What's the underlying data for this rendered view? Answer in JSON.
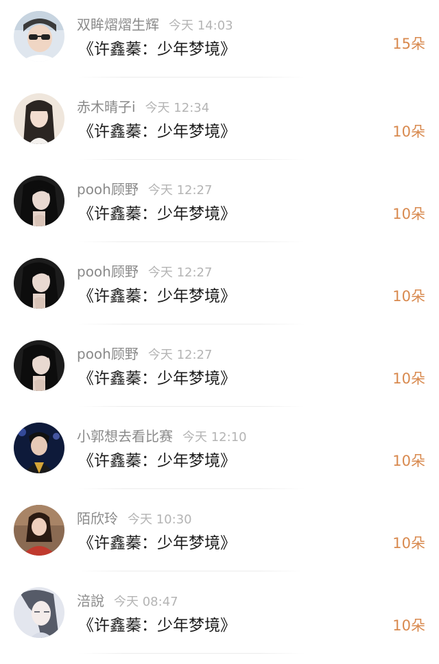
{
  "gift_list": [
    {
      "username": "双眸熠熠生辉",
      "time": "今天 14:03",
      "title": "《许鑫蓁：少年梦境》",
      "amount": "15朵",
      "avatar": "avatar-girl-glasses-icon"
    },
    {
      "username": "赤木晴子i",
      "time": "今天 12:34",
      "title": "《许鑫蓁：少年梦境》",
      "amount": "10朵",
      "avatar": "avatar-girl-long-hair-icon"
    },
    {
      "username": "pooh顾野",
      "time": "今天 12:27",
      "title": "《许鑫蓁：少年梦境》",
      "amount": "10朵",
      "avatar": "avatar-woman-dark-hair-icon"
    },
    {
      "username": "pooh顾野",
      "time": "今天 12:27",
      "title": "《许鑫蓁：少年梦境》",
      "amount": "10朵",
      "avatar": "avatar-woman-dark-hair-icon"
    },
    {
      "username": "pooh顾野",
      "time": "今天 12:27",
      "title": "《许鑫蓁：少年梦境》",
      "amount": "10朵",
      "avatar": "avatar-woman-dark-hair-icon"
    },
    {
      "username": "小郭想去看比赛",
      "time": "今天 12:10",
      "title": "《许鑫蓁：少年梦境》",
      "amount": "10朵",
      "avatar": "avatar-performer-stage-icon"
    },
    {
      "username": "陌欣玲",
      "time": "今天 10:30",
      "title": "《许鑫蓁：少年梦境》",
      "amount": "10朵",
      "avatar": "avatar-girl-red-outfit-icon"
    },
    {
      "username": "涪說",
      "time": "今天 08:47",
      "title": "《许鑫蓁：少年梦境》",
      "amount": "10朵",
      "avatar": "avatar-illustrated-woman-icon"
    }
  ],
  "colors": {
    "amount": "#d8894e",
    "username": "#8a8a8a",
    "time": "#b4b4b4",
    "title": "#1c1c1c"
  }
}
